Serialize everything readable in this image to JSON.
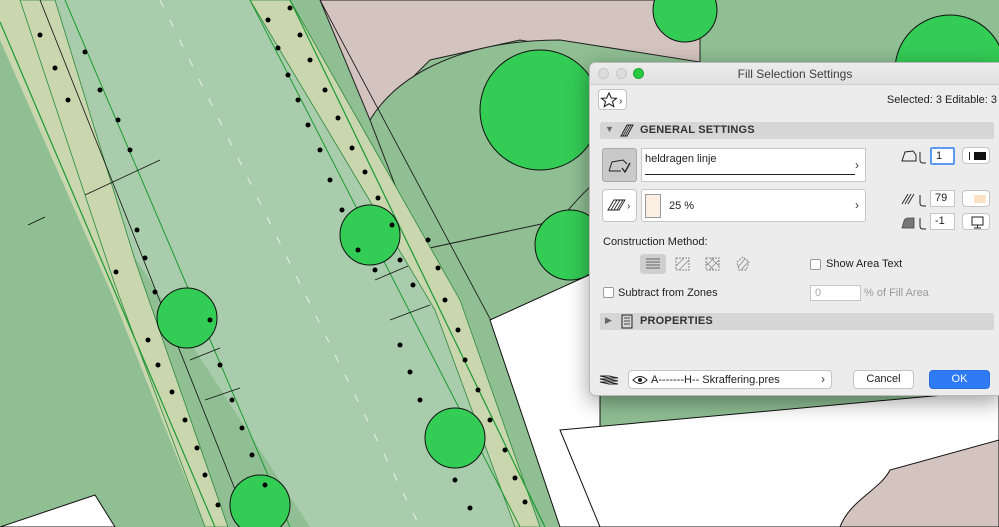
{
  "window": {
    "title": "Fill Selection Settings",
    "selection_info": "Selected: 3 Editable: 3"
  },
  "general_settings": {
    "header": "GENERAL SETTINGS",
    "line_type_label": "heldragen linje",
    "line_pen_value": "1",
    "fill_percent_label": "25 %",
    "fill_pen_value": "79",
    "background_pen_value": "-1"
  },
  "construction": {
    "label": "Construction Method:",
    "show_area_text_label": "Show Area Text",
    "subtract_zones_label": "Subtract from Zones",
    "fill_area_value": "0",
    "fill_area_label": "% of Fill Area"
  },
  "properties": {
    "header": "PROPERTIES"
  },
  "footer": {
    "layer_label": "A-------H-- Skraffering.pres",
    "cancel_label": "Cancel",
    "ok_label": "OK"
  },
  "colors": {
    "ok_button": "#2f7bf5",
    "traffic_green": "#28c840",
    "tree_green": "#33cc55",
    "lawn_green": "#8fbf93",
    "road_green": "#a9cdac",
    "path_tan": "#c9d6ae"
  }
}
